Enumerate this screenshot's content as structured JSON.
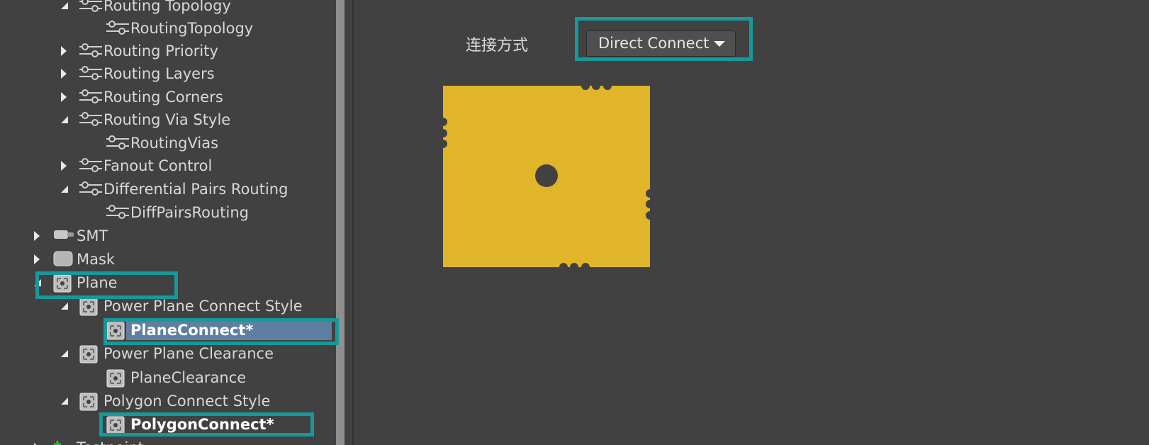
{
  "tree": {
    "items": [
      {
        "label": "Routing Topology",
        "icon": "routing-icon",
        "toggle": "expanded"
      },
      {
        "label": "RoutingTopology",
        "icon": "routing-icon",
        "toggle": "none"
      },
      {
        "label": "Routing Priority",
        "icon": "routing-icon",
        "toggle": "collapsed"
      },
      {
        "label": "Routing Layers",
        "icon": "routing-icon",
        "toggle": "collapsed"
      },
      {
        "label": "Routing Corners",
        "icon": "routing-icon",
        "toggle": "collapsed"
      },
      {
        "label": "Routing Via Style",
        "icon": "routing-icon",
        "toggle": "expanded"
      },
      {
        "label": "RoutingVias",
        "icon": "routing-icon",
        "toggle": "none"
      },
      {
        "label": "Fanout Control",
        "icon": "routing-icon",
        "toggle": "collapsed"
      },
      {
        "label": "Differential Pairs Routing",
        "icon": "routing-icon",
        "toggle": "expanded"
      },
      {
        "label": "DiffPairsRouting",
        "icon": "routing-icon",
        "toggle": "none"
      },
      {
        "label": "SMT",
        "icon": "smt-icon",
        "toggle": "collapsed"
      },
      {
        "label": "Mask",
        "icon": "mask-icon",
        "toggle": "collapsed"
      },
      {
        "label": "Plane",
        "icon": "plane-icon",
        "toggle": "expanded"
      },
      {
        "label": "Power Plane Connect Style",
        "icon": "plane-icon",
        "toggle": "expanded"
      },
      {
        "label": "PlaneConnect*",
        "icon": "plane-icon",
        "toggle": "none",
        "selected": true
      },
      {
        "label": "Power Plane Clearance",
        "icon": "plane-icon",
        "toggle": "expanded"
      },
      {
        "label": "PlaneClearance",
        "icon": "plane-icon",
        "toggle": "none"
      },
      {
        "label": "Polygon Connect Style",
        "icon": "plane-icon",
        "toggle": "expanded"
      },
      {
        "label": "PolygonConnect*",
        "icon": "plane-icon",
        "toggle": "none"
      },
      {
        "label": "Testpoint",
        "icon": "testpoint-icon",
        "toggle": "collapsed"
      }
    ]
  },
  "main": {
    "connect_label": "连接方式",
    "connect_value": "Direct Connect"
  },
  "colors": {
    "background": "#414141",
    "highlight": "#17999a",
    "selection": "#5f7fa0",
    "plane_fill": "#e0b52a",
    "via": "#414141"
  }
}
